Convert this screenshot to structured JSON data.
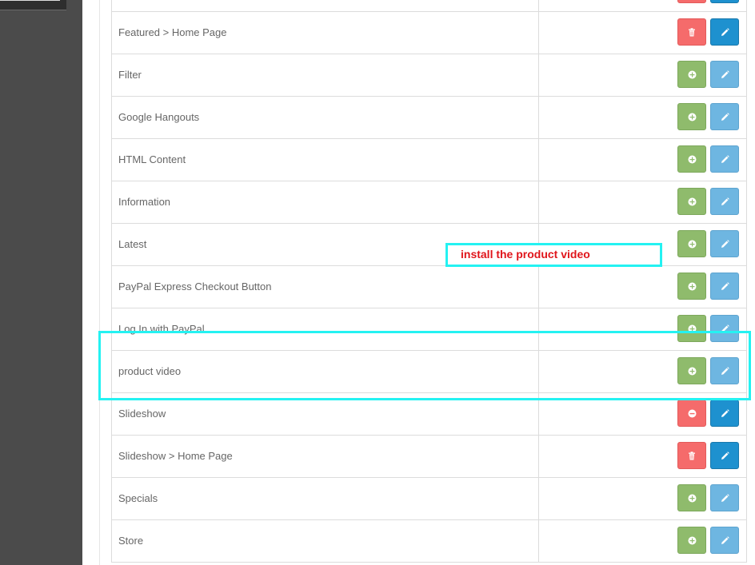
{
  "rows": [
    {
      "name": "",
      "primary_action": "uninstall",
      "primary_color": "red",
      "secondary_color": "blue"
    },
    {
      "name": "Featured > Home Page",
      "primary_action": "delete",
      "primary_color": "red",
      "secondary_color": "blue"
    },
    {
      "name": "Filter",
      "primary_action": "install",
      "primary_color": "green",
      "secondary_color": "lightblue"
    },
    {
      "name": "Google Hangouts",
      "primary_action": "install",
      "primary_color": "green",
      "secondary_color": "lightblue"
    },
    {
      "name": "HTML Content",
      "primary_action": "install",
      "primary_color": "green",
      "secondary_color": "lightblue"
    },
    {
      "name": "Information",
      "primary_action": "install",
      "primary_color": "green",
      "secondary_color": "lightblue"
    },
    {
      "name": "Latest",
      "primary_action": "install",
      "primary_color": "green",
      "secondary_color": "lightblue"
    },
    {
      "name": "PayPal Express Checkout Button",
      "primary_action": "install",
      "primary_color": "green",
      "secondary_color": "lightblue"
    },
    {
      "name": "Log In with PayPal",
      "primary_action": "install",
      "primary_color": "green",
      "secondary_color": "lightblue"
    },
    {
      "name": "product video",
      "primary_action": "install",
      "primary_color": "green",
      "secondary_color": "lightblue"
    },
    {
      "name": "Slideshow",
      "primary_action": "uninstall",
      "primary_color": "red",
      "secondary_color": "blue"
    },
    {
      "name": "Slideshow > Home Page",
      "primary_action": "delete",
      "primary_color": "red",
      "secondary_color": "blue"
    },
    {
      "name": "Specials",
      "primary_action": "install",
      "primary_color": "green",
      "secondary_color": "lightblue"
    },
    {
      "name": "Store",
      "primary_action": "install",
      "primary_color": "green",
      "secondary_color": "lightblue"
    }
  ],
  "annotation": {
    "callout_text": "install the product video",
    "highlight_color": "#24f2f2",
    "text_color": "#e0151b"
  },
  "colors": {
    "green": "#8fbb6c",
    "red": "#f56b6b",
    "blue": "#1e91cf",
    "lightblue": "#6eb6e1",
    "sidebar": "#4b4b4b"
  }
}
